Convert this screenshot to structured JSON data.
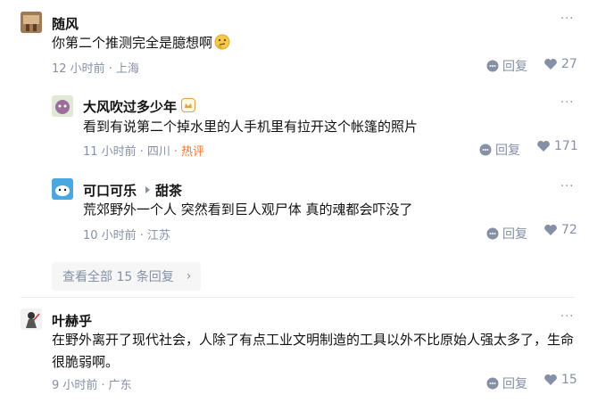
{
  "comments": [
    {
      "user": "随风",
      "content": "你第二个推测完全是臆想啊",
      "time": "12 小时前",
      "location": "上海",
      "reply_label": "回复",
      "likes": "27"
    },
    {
      "user": "大风吹过多少年",
      "content": "看到有说第二个掉水里的人手机里有拉开这个帐篷的照片",
      "time": "11 小时前",
      "location": "四川",
      "hot": "热评",
      "reply_label": "回复",
      "likes": "171"
    },
    {
      "user": "可口可乐",
      "reply_to": "甜茶",
      "content": "荒郊野外一个人 突然看到巨人观尸体 真的魂都会吓没了",
      "time": "10 小时前",
      "location": "江苏",
      "reply_label": "回复",
      "likes": "72"
    },
    {
      "user": "叶赫乎",
      "content": "在野外离开了现代社会，人除了有点工业文明制造的工具以外不比原始人强太多了，生命很脆弱啊。",
      "time": "9 小时前",
      "location": "广东",
      "reply_label": "回复",
      "likes": "15"
    }
  ],
  "separator": "·",
  "more_icon_text": "···",
  "show_all_label": "查看全部 15 条回复",
  "show_all_chevron": "›",
  "colors": {
    "meta": "#8590a6",
    "hot": "#f1782a",
    "text": "#121212"
  }
}
